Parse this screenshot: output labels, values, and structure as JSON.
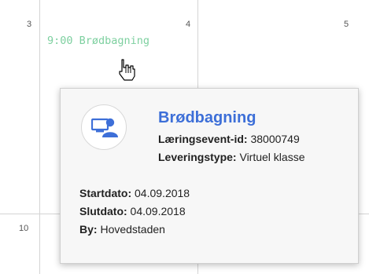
{
  "calendar": {
    "days": [
      "3",
      "4",
      "5",
      "10"
    ],
    "event_label": "9:00 Brødbagning"
  },
  "popover": {
    "title": "Brødbagning",
    "event_id_label": "Læringsevent-id:",
    "event_id_value": " 38000749",
    "delivery_type_label": "Leveringstype:",
    "delivery_type_value": " Virtuel klasse",
    "start_label": "Startdato:",
    "start_value": " 04.09.2018",
    "end_label": "Slutdato:",
    "end_value": " 04.09.2018",
    "city_label": "By:",
    "city_value": " Hovedstaden",
    "icon": "virtual-classroom-icon"
  },
  "colors": {
    "event_text": "#7ed0a0",
    "title": "#3d6fd8",
    "icon": "#3d6fd8"
  }
}
